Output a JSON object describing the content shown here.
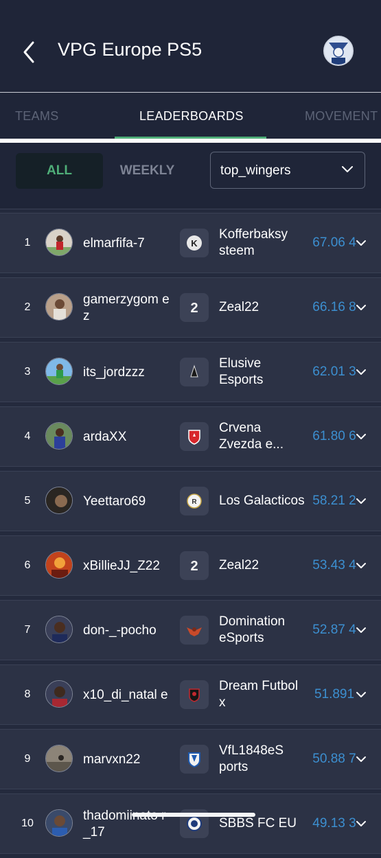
{
  "header": {
    "title": "VPG Europe PS5"
  },
  "tabs": [
    {
      "label": "TEAMS"
    },
    {
      "label": "LEADERBOARDS"
    },
    {
      "label": "MOVEMENT"
    }
  ],
  "filters": {
    "all_label": "ALL",
    "weekly_label": "WEEKLY",
    "dropdown_value": "top_wingers"
  },
  "colors": {
    "accent": "#4fae78",
    "score": "#3c8fd0",
    "background": "#242a3d"
  },
  "rows": [
    {
      "rank": "1",
      "player": "elmarfifa-7",
      "team": "Kofferbaksy steem",
      "score": "67.06 4"
    },
    {
      "rank": "2",
      "player": "gamerzygom ez",
      "team": "Zeal22",
      "score": "66.16 8"
    },
    {
      "rank": "3",
      "player": "its_jordzzz",
      "team": "Elusive Esports",
      "score": "62.01 3"
    },
    {
      "rank": "4",
      "player": "ardaXX",
      "team": "Crvena Zvezda e...",
      "score": "61.80 6"
    },
    {
      "rank": "5",
      "player": "Yeettaro69",
      "team": "Los Galacticos",
      "score": "58.21 2"
    },
    {
      "rank": "6",
      "player": "xBillieJJ_Z22",
      "team": "Zeal22",
      "score": "53.43 4"
    },
    {
      "rank": "7",
      "player": "don-_-pocho",
      "team": "Domination eSports",
      "score": "52.87 4"
    },
    {
      "rank": "8",
      "player": "x10_di_natal e",
      "team": "Dream Futbol x",
      "score": "51.891"
    },
    {
      "rank": "9",
      "player": "marvxn22",
      "team": "VfL1848eS ports",
      "score": "50.88 7"
    },
    {
      "rank": "10",
      "player": "thadomiinato r_17",
      "team": "SBBS FC EU",
      "score": "49.13 3"
    }
  ]
}
